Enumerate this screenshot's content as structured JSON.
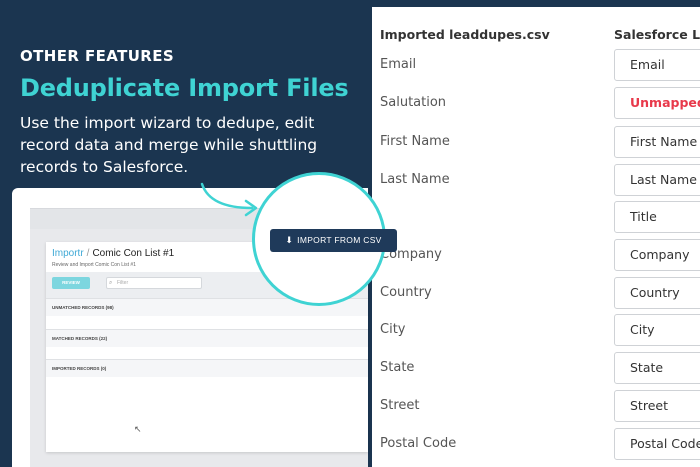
{
  "hero": {
    "eyebrow": "OTHER FEATURES",
    "headline": "Deduplicate Import Files",
    "description": "Use the import wizard to dedupe, edit record data and merge while shuttling records to Salesforce."
  },
  "app": {
    "brand": "Importr",
    "separator": "/",
    "list_title": "Comic Con List #1",
    "subtitle": "Review and Import Comic Con List #1",
    "review_label": "REVIEW",
    "filter_placeholder": "Filter",
    "sections": [
      "UNMATCHED RECORDS (98)",
      "MATCHED RECORDS (22)",
      "IMPORTED RECORDS (0)"
    ]
  },
  "callout": {
    "import_button_label": "IMPORT FROM CSV"
  },
  "mapping": {
    "left_header": "Imported leaddupes.csv",
    "right_header": "Salesforce Le",
    "rows": [
      {
        "source": "Email",
        "target": "Email",
        "unmapped": false
      },
      {
        "source": "Salutation",
        "target": "Unmapped",
        "unmapped": true
      },
      {
        "source": "First Name",
        "target": "First Name",
        "unmapped": false
      },
      {
        "source": "Last Name",
        "target": "Last Name",
        "unmapped": false
      },
      {
        "source": "",
        "target": "Title",
        "unmapped": false
      },
      {
        "source": "Company",
        "target": "Company",
        "unmapped": false
      },
      {
        "source": "Country",
        "target": "Country",
        "unmapped": false
      },
      {
        "source": "City",
        "target": "City",
        "unmapped": false
      },
      {
        "source": "State",
        "target": "State",
        "unmapped": false
      },
      {
        "source": "Street",
        "target": "Street",
        "unmapped": false
      },
      {
        "source": "Postal Code",
        "target": "Postal Code",
        "unmapped": false
      }
    ]
  },
  "colors": {
    "background": "#1b3550",
    "accent_teal": "#3fd3d3",
    "button_navy": "#1f3a5a",
    "unmapped_red": "#e8394b"
  }
}
